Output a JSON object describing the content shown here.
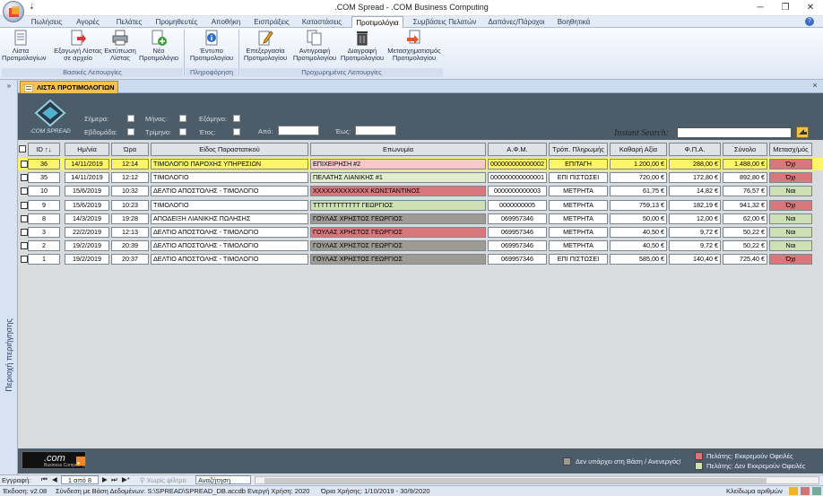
{
  "window": {
    "title": ".COM Spread - .COM Business Computing"
  },
  "quick_access": "⇣",
  "menu": [
    "Πωλήσεις",
    "Αγορές",
    "Πελάτες",
    "Προμηθευτές",
    "Αποθήκη",
    "Εισπράξεις",
    "Καταστάσεις",
    "Προτιμολόγια",
    "Συμβάσεις Πελατών",
    "Δαπάνες/Πάροχοι",
    "Βοηθητικά"
  ],
  "ribbon": {
    "groups": [
      "Βασικές Λειτουργίες",
      "Πληροφόρηση",
      "Προχωρημένες Λειτουργίες"
    ],
    "buttons": [
      {
        "l1": "Λίστα",
        "l2": "Προτιμολογίων",
        "icon": "list-icon"
      },
      {
        "l1": "Εξαγωγή Λίστας",
        "l2": "σε αρχείο",
        "icon": "export-icon"
      },
      {
        "l1": "Εκτύπωση",
        "l2": "Λίστας",
        "icon": "printer-icon"
      },
      {
        "l1": "Νέο",
        "l2": "Προτιμολόγιο",
        "icon": "new-document-icon"
      },
      {
        "l1": "Έντυπο",
        "l2": "Προτιμολογίου",
        "icon": "info-icon"
      },
      {
        "l1": "Επεξεργασία",
        "l2": "Προτιμολογίου",
        "icon": "edit-icon"
      },
      {
        "l1": "Αντιγραφή",
        "l2": "Προτιμολογίου",
        "icon": "copy-icon"
      },
      {
        "l1": "Διαγραφή",
        "l2": "Προτιμολογίου",
        "icon": "trash-icon"
      },
      {
        "l1": "Μετασχηματισμός",
        "l2": "Προτιμολογίου",
        "icon": "transform-icon"
      }
    ]
  },
  "nav": {
    "toggle": "»",
    "label": "Περιοχή περιήγησης"
  },
  "tab": {
    "label": "ΛΙΣΤΑ ΠΡΟΤΙΜΟΛΟΓΙΩΝ",
    "close": "×"
  },
  "filters": {
    "today": "Σήμερα:",
    "month": "Μήνας:",
    "semester": "Εξάμηνο:",
    "week": "Εβδομάδα:",
    "quarter": "Τρίμηνο:",
    "year": "Έτος:",
    "from": "Από:",
    "to": "Έως:",
    "logo_text": ".COM SPREAD"
  },
  "search": {
    "label": "Instant Search:",
    "value": ""
  },
  "table": {
    "columns": [
      "ID ↑↓",
      "Ημ/νία",
      "Ώρα",
      "Είδος Παραστατικού",
      "Επωνυμία",
      "Α.Φ.Μ.",
      "Τρόπ. Πληρωμής",
      "Καθαρή Αξία",
      "Φ.Π.Α.",
      "Σύνολο",
      "Μετασχ/μός"
    ],
    "rows": [
      [
        "36",
        "14/11/2019",
        "12:14",
        "ΤΙΜΟΛΟΓΙΟ ΠΑΡΟΧΗΣ ΥΠΗΡΕΣΙΩΝ",
        "ΕΠΙΧΕΙΡΗΣΗ #2",
        "000000000000002",
        "ΕΠΙΤΑΓΗ",
        "1.200,00 €",
        "288,00 €",
        "1.488,00 €",
        "Όχι"
      ],
      [
        "35",
        "14/11/2019",
        "12:12",
        "ΤΙΜΟΛΟΓΙΟ",
        "ΠΕΛΑΤΗΣ ΛΙΑΝΙΚΗΣ #1",
        "000000000000001",
        "ΕΠΙ ΠΙΣΤΩΣΕΙ",
        "720,00 €",
        "172,80 €",
        "892,80 €",
        "Όχι"
      ],
      [
        "10",
        "15/6/2019",
        "10:32",
        "ΔΕΛΤΙΟ ΑΠΟΣΤΟΛΗΣ - ΤΙΜΟΛΟΓΙΟ",
        "ΧΧΧΧΧΧΧΧΧΧΧΧΧ ΚΩΝΣΤΑΝΤΙΝΟΣ",
        "0000000000003",
        "ΜΕΤΡΗΤΑ",
        "61,75 €",
        "14,82 €",
        "76,57 €",
        "Ναι"
      ],
      [
        "9",
        "15/6/2019",
        "10:23",
        "ΤΙΜΟΛΟΓΙΟ",
        "ΤΤΤΤΤΤΤΤΤΤΤΤ ΓΕΩΡΓΙΟΣ",
        "0000000005",
        "ΜΕΤΡΗΤΑ",
        "759,13 €",
        "182,19 €",
        "941,32 €",
        "Όχι"
      ],
      [
        "8",
        "14/3/2019",
        "19:28",
        "ΑΠΟΔΕΙΞΗ ΛΙΑΝΙΚΗΣ ΠΩΛΗΣΗΣ",
        "ΓΟΥΛΑΣ ΧΡΗΣΤΟΣ ΓΕΩΡΓΙΟΣ",
        "069957346",
        "ΜΕΤΡΗΤΑ",
        "50,00 €",
        "12,00 €",
        "62,00 €",
        "Ναι"
      ],
      [
        "3",
        "22/2/2019",
        "12:13",
        "ΔΕΛΤΙΟ ΑΠΟΣΤΟΛΗΣ - ΤΙΜΟΛΟΓΙΟ",
        "ΓΟΥΛΑΣ ΧΡΗΣΤΟΣ ΓΕΩΡΓΙΟΣ",
        "069957346",
        "ΜΕΤΡΗΤΑ",
        "40,50 €",
        "9,72 €",
        "50,22 €",
        "Ναι"
      ],
      [
        "2",
        "19/2/2019",
        "20:39",
        "ΔΕΛΤΙΟ ΑΠΟΣΤΟΛΗΣ - ΤΙΜΟΛΟΓΙΟ",
        "ΓΟΥΛΑΣ ΧΡΗΣΤΟΣ ΓΕΩΡΓΙΟΣ",
        "069957346",
        "ΜΕΤΡΗΤΑ",
        "40,50 €",
        "9,72 €",
        "50,22 €",
        "Ναι"
      ],
      [
        "1",
        "19/2/2019",
        "20:37",
        "ΔΕΛΤΙΟ ΑΠΟΣΤΟΛΗΣ - ΤΙΜΟΛΟΓΙΟ",
        "ΓΟΥΛΑΣ ΧΡΗΣΤΟΣ ΓΕΩΡΓΙΟΣ",
        "069957346",
        "ΕΠΙ ΠΙΣΤΩΣΕΙ",
        "585,00 €",
        "140,40 €",
        "725,40 €",
        "Όχι"
      ]
    ]
  },
  "legend": {
    "not_in_base": "Δεν υπάρχει στη Βάση / Ανενεργός!",
    "owes": "Πελάτης: Εκκρεμούν Οφειλές",
    "no_owes": "Πελάτης: Δεν Εκκρεμούν Οφειλές",
    "c_gray": "#9e9b94",
    "c_red": "#d9787c",
    "c_green": "#cfe0b4"
  },
  "footer_logo": ".com",
  "footer_logo_sub": "Business Computing",
  "recnav": {
    "label": "Εγγραφή:",
    "position": "1 από 8",
    "filter": "Χωρίς φίλτρο",
    "search": "Αναζήτηση"
  },
  "status": {
    "version": "Έκδοση: v2.08",
    "db": "Σύνδεση με Βάση Δεδομένων: S:\\SPREAD\\SPREAD_DB.accdb",
    "active_year": "Ενεργή Χρήση: 2020",
    "limits": "Όρια Χρήσης: 1/10/2019 - 30/9/2020",
    "numlock": "Κλείδωμα αριθμών"
  }
}
